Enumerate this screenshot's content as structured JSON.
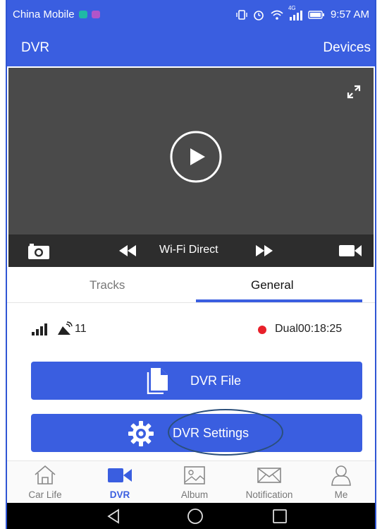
{
  "status_bar": {
    "carrier": "China Mobile",
    "network": "4G",
    "time": "9:57 AM"
  },
  "app_bar": {
    "title": "DVR",
    "devices_label": "Devices"
  },
  "video": {
    "mode_label": "Wi-Fi Direct"
  },
  "tabs": [
    {
      "label": "Tracks",
      "active": false
    },
    {
      "label": "General",
      "active": true
    }
  ],
  "info": {
    "satellites": "11",
    "recording": "Dual00:18:25",
    "recording_color": "#e8202a"
  },
  "buttons": {
    "file_label": "DVR File",
    "settings_label": "DVR Settings"
  },
  "bottom_nav": [
    {
      "label": "Car Life",
      "icon": "home-icon",
      "active": false
    },
    {
      "label": "DVR",
      "icon": "video-camera-icon",
      "active": true
    },
    {
      "label": "Album",
      "icon": "image-icon",
      "active": false
    },
    {
      "label": "Notification",
      "icon": "envelope-icon",
      "active": false
    },
    {
      "label": "Me",
      "icon": "person-icon",
      "active": false
    }
  ],
  "colors": {
    "accent": "#3a5ee0",
    "video_bg": "#4a4a4a",
    "control_bar": "#2d2d2d"
  }
}
